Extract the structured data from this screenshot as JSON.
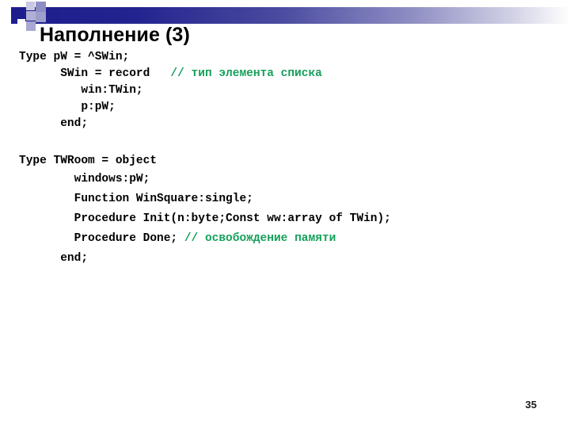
{
  "slide": {
    "title": "Наполнение (3)",
    "page_number": "35",
    "colors": {
      "accent_navy": "#1d1d8d",
      "comment_green": "#16a05b",
      "text_black": "#000000",
      "background": "#ffffff"
    }
  },
  "code": {
    "lines": [
      {
        "indent": "",
        "text": "Type pW = ^SWin;",
        "comment": ""
      },
      {
        "indent": "      ",
        "text": "SWin = record",
        "comment": "   // тип элемента списка"
      },
      {
        "indent": "         ",
        "text": "win:TWin;",
        "comment": ""
      },
      {
        "indent": "         ",
        "text": "p:pW;",
        "comment": ""
      },
      {
        "indent": "      ",
        "text": "end;",
        "comment": ""
      },
      {
        "indent": "",
        "text": "",
        "comment": ""
      },
      {
        "indent": "",
        "text": "Type TWRoom = object",
        "comment": ""
      },
      {
        "indent": "        ",
        "text": "windows:pW;",
        "comment": ""
      },
      {
        "indent": "        ",
        "text": "Function WinSquare:single;",
        "comment": ""
      },
      {
        "indent": "        ",
        "text": "Procedure Init(n:byte;Const ww:array of TWin);",
        "comment": ""
      },
      {
        "indent": "        ",
        "text": "Procedure Done; ",
        "comment": "// освобождение памяти"
      },
      {
        "indent": "      ",
        "text": "end;",
        "comment": ""
      }
    ]
  }
}
